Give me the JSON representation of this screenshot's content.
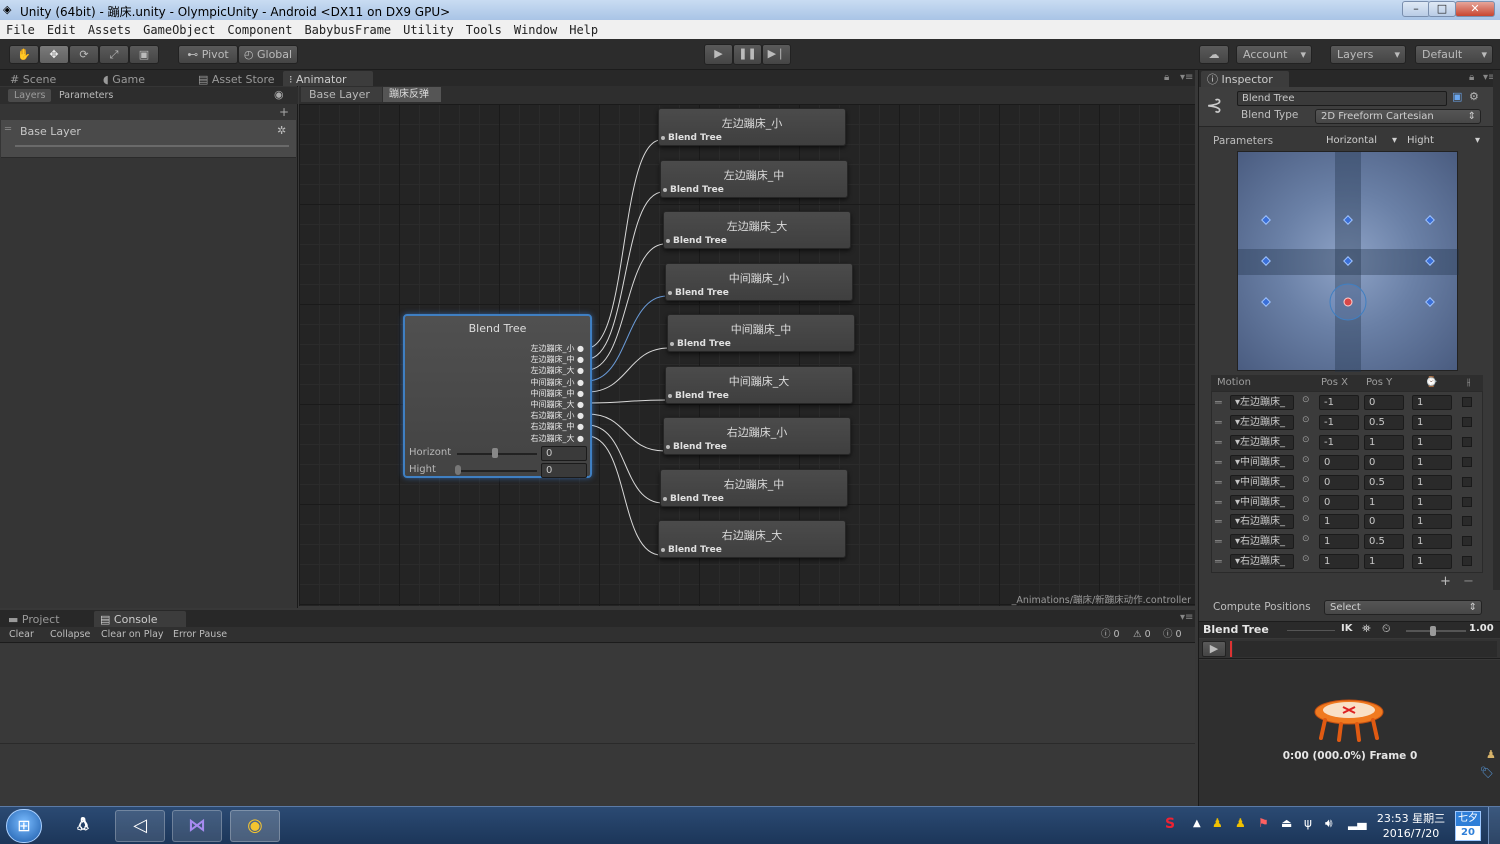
{
  "window": {
    "title": "Unity (64bit) - 蹦床.unity - OlympicUnity - Android <DX11 on DX9 GPU>",
    "minimize_glyph": "–",
    "maximize_glyph": "□",
    "close_glyph": "✕"
  },
  "menu": [
    "File",
    "Edit",
    "Assets",
    "GameObject",
    "Component",
    "BabybusFrame",
    "Utility",
    "Tools",
    "Window",
    "Help"
  ],
  "toolbar": {
    "pivot": "Pivot",
    "global": "Global",
    "account": "Account",
    "layers": "Layers",
    "layout": "Default"
  },
  "tabs": {
    "scene": "Scene",
    "game": "Game",
    "asset_store": "Asset Store",
    "animator": "Animator",
    "inspector": "Inspector",
    "project": "Project",
    "console": "Console"
  },
  "animator": {
    "sub_tabs": [
      "Layers",
      "Parameters"
    ],
    "breadcrumb": [
      "Base Layer",
      "蹦床反弹"
    ],
    "layer_name": "Base Layer",
    "main_node": {
      "title": "Blend Tree",
      "outputs": [
        "左边蹦床_小",
        "左边蹦床_中",
        "左边蹦床_大",
        "中间蹦床_小",
        "中间蹦床_中",
        "中间蹦床_大",
        "右边蹦床_小",
        "右边蹦床_中",
        "右边蹦床_大"
      ],
      "params": [
        {
          "name": "Horizont",
          "value": "0"
        },
        {
          "name": "Hight",
          "value": "0"
        }
      ]
    },
    "child_nodes": [
      {
        "title": "左边蹦床_小",
        "subtitle": "Blend Tree"
      },
      {
        "title": "左边蹦床_中",
        "subtitle": "Blend Tree"
      },
      {
        "title": "左边蹦床_大",
        "subtitle": "Blend Tree"
      },
      {
        "title": "中间蹦床_小",
        "subtitle": "Blend Tree"
      },
      {
        "title": "中间蹦床_中",
        "subtitle": "Blend Tree"
      },
      {
        "title": "中间蹦床_大",
        "subtitle": "Blend Tree"
      },
      {
        "title": "右边蹦床_小",
        "subtitle": "Blend Tree"
      },
      {
        "title": "右边蹦床_中",
        "subtitle": "Blend Tree"
      },
      {
        "title": "右边蹦床_大",
        "subtitle": "Blend Tree"
      }
    ],
    "footer_path": "_Animations/蹦床/新蹦床动作.controller"
  },
  "console": {
    "buttons": [
      "Clear",
      "Collapse",
      "Clear on Play",
      "Error Pause"
    ],
    "counts": {
      "info": "0",
      "warn": "0",
      "error": "0"
    }
  },
  "inspector": {
    "name_value": "Blend Tree",
    "blend_type_label": "Blend Type",
    "blend_type_value": "2D Freeform Cartesian",
    "parameters_label": "Parameters",
    "param_x": "Horizontal",
    "param_y": "Hight",
    "table_headers": [
      "Motion",
      "Pos X",
      "Pos Y"
    ],
    "motions": [
      {
        "motion": "左边蹦床_",
        "x": "-1",
        "y": "0",
        "speed": "1"
      },
      {
        "motion": "左边蹦床_",
        "x": "-1",
        "y": "0.5",
        "speed": "1"
      },
      {
        "motion": "左边蹦床_",
        "x": "-1",
        "y": "1",
        "speed": "1"
      },
      {
        "motion": "中间蹦床_",
        "x": "0",
        "y": "0",
        "speed": "1"
      },
      {
        "motion": "中间蹦床_",
        "x": "0",
        "y": "0.5",
        "speed": "1"
      },
      {
        "motion": "中间蹦床_",
        "x": "0",
        "y": "1",
        "speed": "1"
      },
      {
        "motion": "右边蹦床_",
        "x": "1",
        "y": "0",
        "speed": "1"
      },
      {
        "motion": "右边蹦床_",
        "x": "1",
        "y": "0.5",
        "speed": "1"
      },
      {
        "motion": "右边蹦床_",
        "x": "1",
        "y": "1",
        "speed": "1"
      }
    ],
    "compute_positions_label": "Compute Positions",
    "compute_positions_value": "Select",
    "preview_title": "Blend Tree",
    "preview_ik": "IK",
    "preview_speed": "1.00",
    "preview_time": "0:00 (000.0%) Frame 0"
  },
  "taskbar": {
    "time": "23:53 星期三",
    "date": "2016/7/20",
    "lang": "七夕",
    "day": "20"
  },
  "colors": {
    "selection_blue": "#3f7fc2",
    "graph_bg": "#242424",
    "panel_bg": "#383838"
  }
}
